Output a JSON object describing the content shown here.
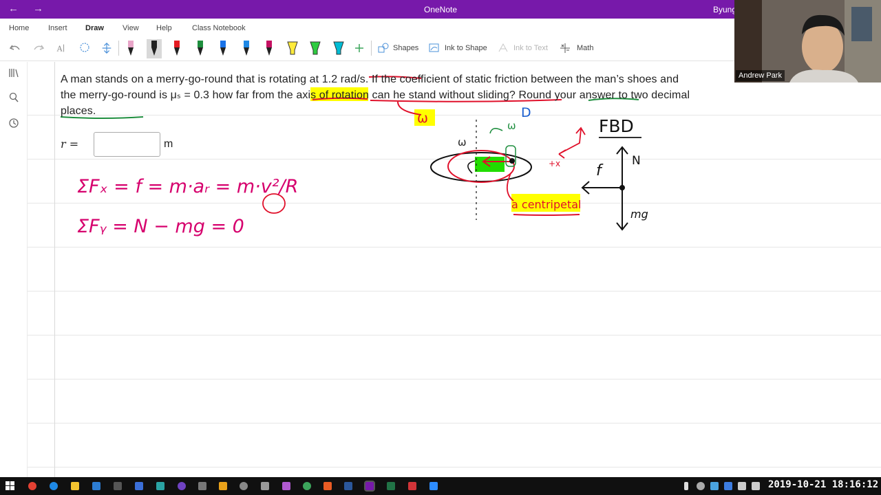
{
  "app": {
    "title": "OneNote",
    "user": "Byung"
  },
  "menu": {
    "tabs": [
      "Home",
      "Insert",
      "Draw",
      "View",
      "Help",
      "Class Notebook"
    ],
    "active": "Draw"
  },
  "ribbon": {
    "shapes": "Shapes",
    "ink_to_shape": "Ink to Shape",
    "ink_to_text": "Ink to Text",
    "math": "Math"
  },
  "pens": [
    "#e8a5c8",
    "#222222",
    "#e51c23",
    "#1e8e3e",
    "#1a73e8",
    "#1e88e5",
    "#c51162",
    "#ffeb3b",
    "#2ecc40",
    "#00bcd4"
  ],
  "problem": {
    "text": "A man stands on a merry-go-round that is rotating at 1.2 rad/s. If the coefficient of static friction between the man’s shoes and the merry-go-round is μₛ = 0.3 how far from the axis of rotation can he stand without sliding? Round your answer to two decimal places."
  },
  "answer": {
    "label": "r =",
    "value": "",
    "unit": "m"
  },
  "ink": {
    "eq1": "ΣFₓ = f = m·aᵣ = m·v²/R",
    "eq2": "ΣFᵧ = N − mg = 0",
    "omega_red": "ω",
    "omega_green": "ω",
    "omega_black": "ω",
    "label_d": "D",
    "fbd_title": "FBD",
    "force_n": "N",
    "force_f": "f",
    "force_mg": "mg",
    "plus_x": "+x",
    "a_centripetal": "a centripetal"
  },
  "webcam": {
    "name": "Andrew Park"
  },
  "taskbar": {
    "clock": "2019-10-21 18:16:12"
  }
}
